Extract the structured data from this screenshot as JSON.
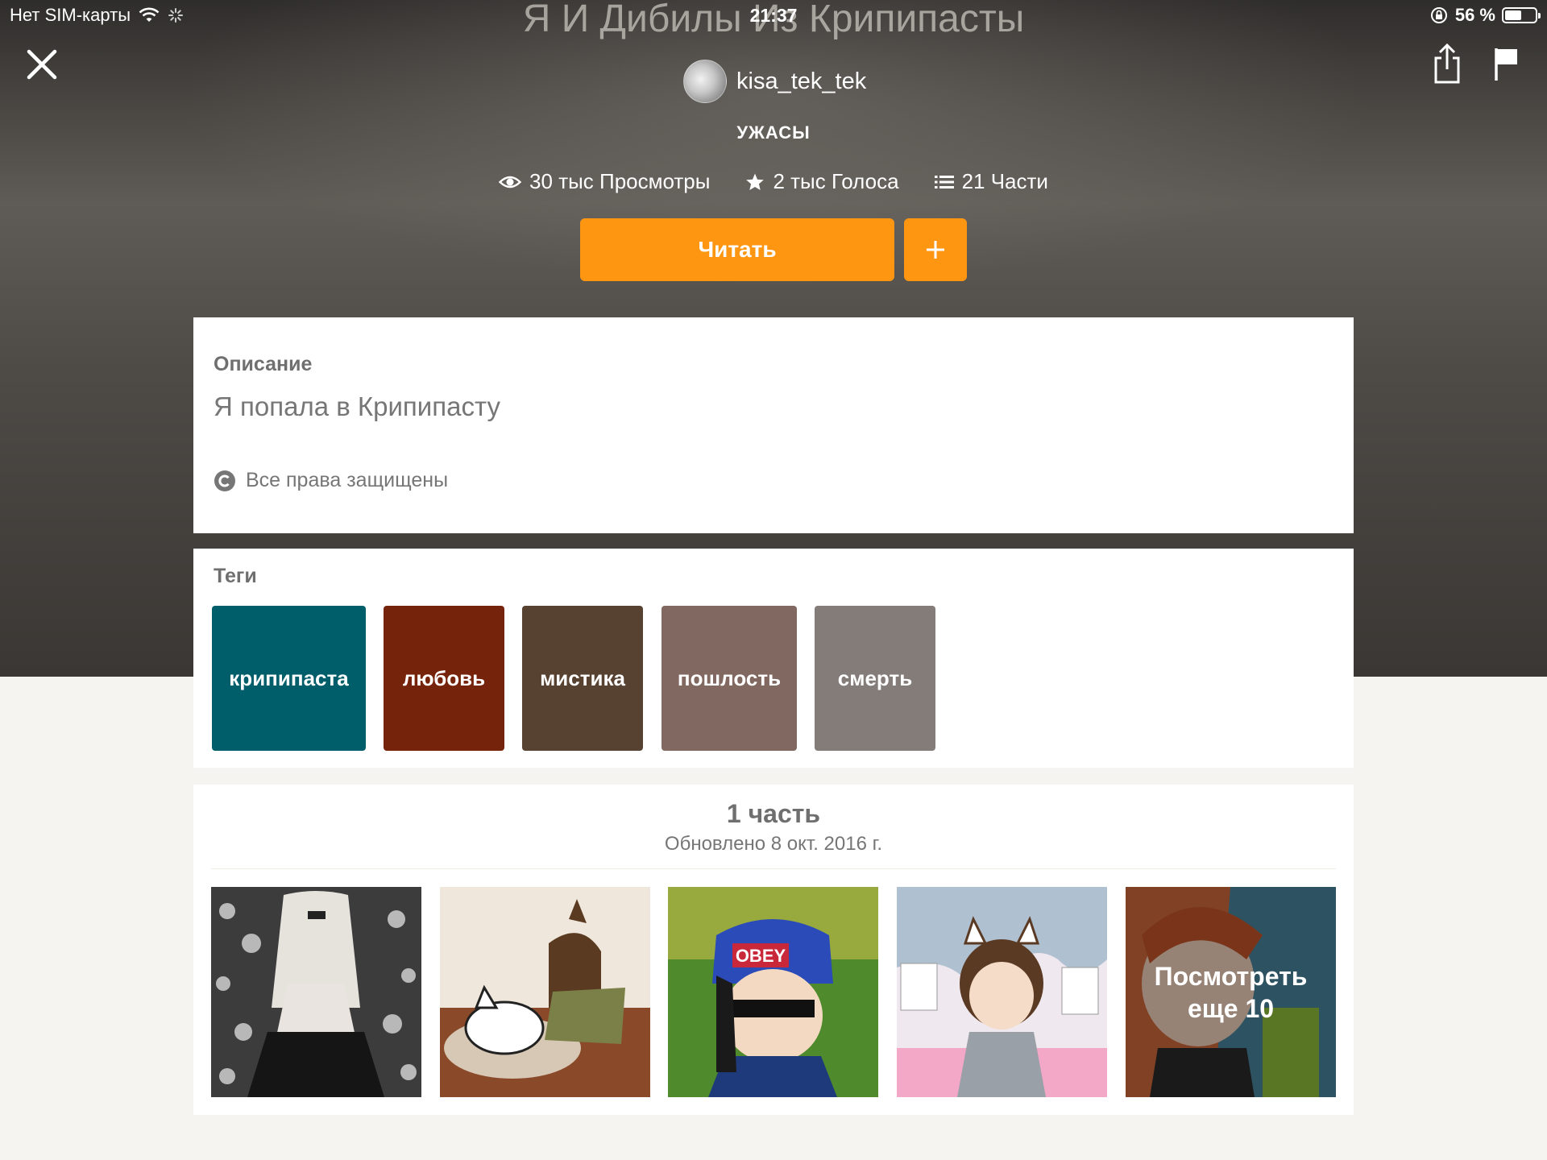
{
  "status_bar": {
    "carrier": "Нет SIM-карты",
    "time": "21:37",
    "battery_percent": "56 %",
    "battery_level": 0.56
  },
  "story": {
    "title": "Я И Дибилы Из Крипипасты",
    "author": "kisa_tek_tek",
    "genre": "УЖАСЫ",
    "stats": {
      "views": "30 тыс Просмотры",
      "votes": "2 тыс Голоса",
      "parts": "21 Части"
    },
    "read_button": "Читать",
    "add_button": "+"
  },
  "description": {
    "heading": "Описание",
    "text": "Я попала в Крипипасту",
    "copyright": "Все права защищены"
  },
  "tags": {
    "heading": "Теги",
    "items": [
      {
        "label": "крипипаста",
        "color": "#005e6a"
      },
      {
        "label": "любовь",
        "color": "#76230b"
      },
      {
        "label": "мистика",
        "color": "#574131"
      },
      {
        "label": "пошлость",
        "color": "#816860"
      },
      {
        "label": "смерть",
        "color": "#837c79"
      }
    ]
  },
  "parts": {
    "count": "1 часть",
    "updated": "Обновлено 8 окт. 2016 г.",
    "more_line1": "Посмотреть",
    "more_line2": "еще 10"
  },
  "colors": {
    "accent": "#ff9612",
    "text_secondary": "#767676"
  }
}
